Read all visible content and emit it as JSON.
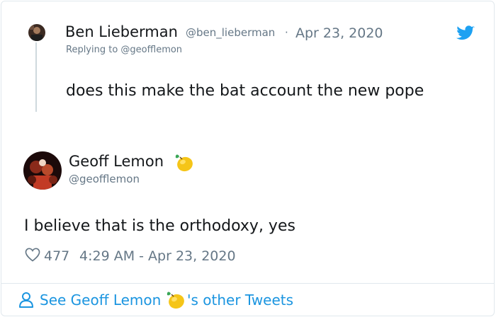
{
  "reply_tweet": {
    "author_name": "Ben Lieberman",
    "author_handle": "@ben_lieberman",
    "separator": "·",
    "date": "Apr 23, 2020",
    "replying_to": "Replying to @geofflemon",
    "text": "does this make the bat account the new pope"
  },
  "main_tweet": {
    "author_name": "Geoff Lemon",
    "author_handle": "@geofflemon",
    "text": "I believe that is the orthodoxy, yes",
    "likes": "477",
    "timestamp": "4:29 AM - Apr 23, 2020"
  },
  "footer": {
    "see_more_prefix": "See Geoff Lemon",
    "see_more_suffix": "'s other Tweets"
  },
  "colors": {
    "twitter_blue": "#1da1f2",
    "link_blue": "#1b95e0",
    "meta_gray": "#657786",
    "border": "#e1e8ed"
  },
  "icons": {
    "brand": "twitter-bird-icon",
    "like": "heart-icon",
    "profile": "person-icon",
    "emoji": "lemon-icon"
  }
}
